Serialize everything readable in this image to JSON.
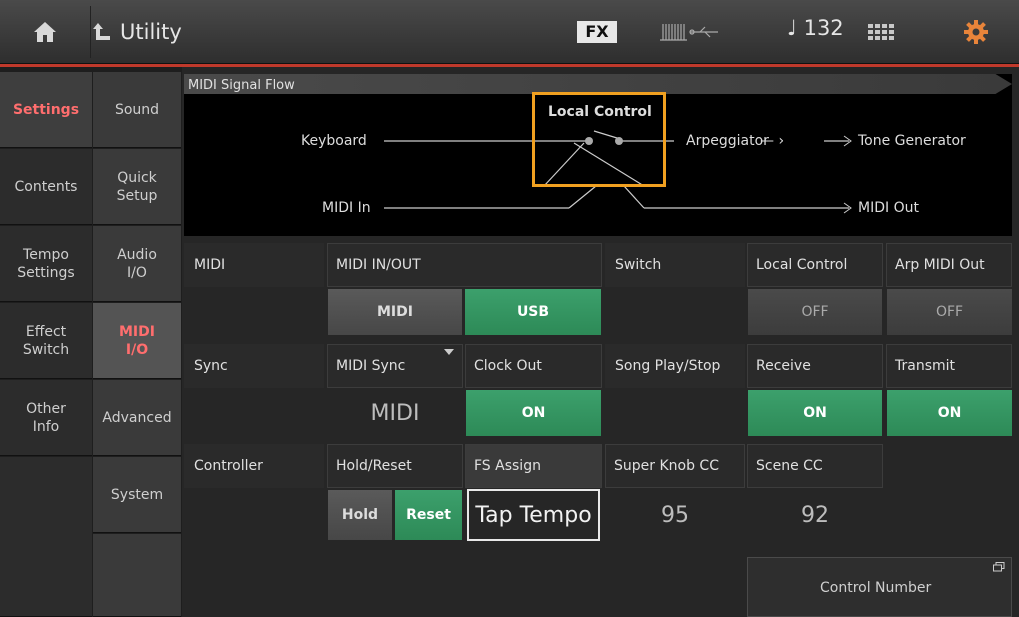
{
  "header": {
    "title": "Utility",
    "fx_badge": "FX",
    "tempo": "♩ 132"
  },
  "nav_primary": [
    {
      "label": "Settings",
      "active": true
    },
    {
      "label": "Contents",
      "active": false
    },
    {
      "label": "Tempo\nSettings",
      "active": false
    },
    {
      "label": "Effect\nSwitch",
      "active": false
    },
    {
      "label": "Other\nInfo",
      "active": false
    }
  ],
  "nav_secondary": [
    {
      "label": "Sound",
      "active": false
    },
    {
      "label": "Quick\nSetup",
      "active": false
    },
    {
      "label": "Audio\nI/O",
      "active": false
    },
    {
      "label": "MIDI\nI/O",
      "active": true
    },
    {
      "label": "Advanced",
      "active": false
    },
    {
      "label": "System",
      "active": false
    }
  ],
  "signal_flow": {
    "title": "MIDI Signal Flow",
    "keyboard": "Keyboard",
    "local_control": "Local Control",
    "arpeggiator": "Arpeggiator",
    "tone_generator": "Tone Generator",
    "midi_in": "MIDI In",
    "midi_out": "MIDI Out"
  },
  "midi": {
    "section": "MIDI",
    "inout_label": "MIDI IN/OUT",
    "midi_btn": "MIDI",
    "usb_btn": "USB"
  },
  "switch": {
    "section": "Switch",
    "local_control_label": "Local Control",
    "local_control_value": "OFF",
    "arp_midi_out_label": "Arp MIDI Out",
    "arp_midi_out_value": "OFF"
  },
  "sync": {
    "section": "Sync",
    "midi_sync_label": "MIDI Sync",
    "midi_sync_value": "MIDI",
    "clock_out_label": "Clock Out",
    "clock_out_value": "ON"
  },
  "song_play_stop": {
    "section": "Song Play/Stop",
    "receive_label": "Receive",
    "receive_value": "ON",
    "transmit_label": "Transmit",
    "transmit_value": "ON"
  },
  "controller": {
    "section": "Controller",
    "hold_reset_label": "Hold/Reset",
    "hold_btn": "Hold",
    "reset_btn": "Reset",
    "fs_assign_label": "FS Assign",
    "fs_assign_value": "Tap Tempo",
    "super_knob_label": "Super Knob CC",
    "super_knob_value": "95",
    "scene_cc_label": "Scene CC",
    "scene_cc_value": "92"
  },
  "control_number": "Control Number",
  "colors": {
    "accent_red": "#c0392b",
    "green": "#2d8a57",
    "highlight_orange": "#f0a020"
  }
}
